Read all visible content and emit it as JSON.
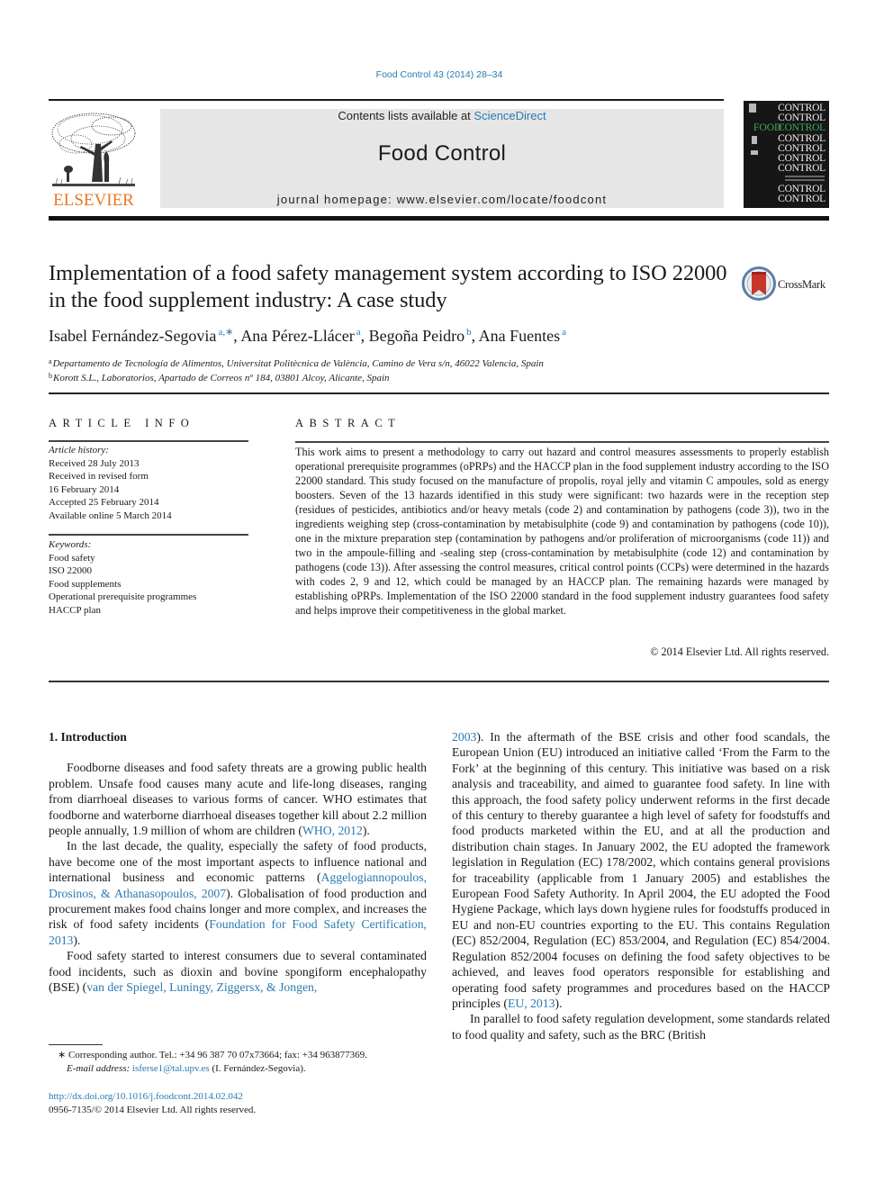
{
  "header": {
    "citation": "Food Control 43 (2014) 28–34",
    "publisher_logo_text": "ELSEVIER",
    "contents_prefix": "Contents lists available at ",
    "contents_link": "ScienceDirect",
    "journal_name": "Food Control",
    "homepage_prefix": "journal homepage: ",
    "homepage_url": "www.elsevier.com/locate/foodcont",
    "cover": {
      "word_control": "CONTROL",
      "word_food": "FOOD"
    },
    "colors": {
      "link": "#2a7ab0",
      "elsevier_orange": "#e87722",
      "masthead_bg": "#e6e6e6",
      "cover_green": "#3fae5a"
    }
  },
  "article": {
    "title": "Implementation of a food safety management system according to ISO 22000 in the food supplement industry: A case study",
    "crossmark_label": "CrossMark",
    "authors": [
      {
        "name": "Isabel Fernández-Segovia",
        "sup": "a,∗"
      },
      {
        "name": "Ana Pérez-Llácer",
        "sup": "a"
      },
      {
        "name": "Begoña Peidro",
        "sup": "b"
      },
      {
        "name": "Ana Fuentes",
        "sup": "a"
      }
    ],
    "affiliations": [
      {
        "mark": "a",
        "text": "Departamento de Tecnología de Alimentos, Universitat Politècnica de València, Camino de Vera s/n, 46022 Valencia, Spain"
      },
      {
        "mark": "b",
        "text": "Korott S.L., Laboratorios, Apartado de Correos nº 184, 03801 Alcoy, Alicante, Spain"
      }
    ]
  },
  "article_info": {
    "heading": "ARTICLE INFO",
    "history_label": "Article history:",
    "history": [
      "Received 28 July 2013",
      "Received in revised form",
      "16 February 2014",
      "Accepted 25 February 2014",
      "Available online 5 March 2014"
    ],
    "keywords_label": "Keywords:",
    "keywords": [
      "Food safety",
      "ISO 22000",
      "Food supplements",
      "Operational prerequisite programmes",
      "HACCP plan"
    ]
  },
  "abstract": {
    "heading": "ABSTRACT",
    "text": "This work aims to present a methodology to carry out hazard and control measures assessments to properly establish operational prerequisite programmes (oPRPs) and the HACCP plan in the food sup­plement industry according to the ISO 22000 standard. This study focused on the manufacture of propolis, royal jelly and vitamin C ampoules, sold as energy boosters. Seven of the 13 hazards identified in this study were significant: two hazards were in the reception step (residues of pesticides, antibiotics and/or heavy metals (code 2) and contamination by pathogens (code 3)), two in the ingredients weighing step (cross-contamination by metabisulphite (code 9) and contamination by pathogens (code 10)), one in the mixture preparation step (contamination by pathogens and/or proliferation of microorganisms (code 11)) and two in the ampoule-filling and -sealing step (cross-contamination by metabisulphite (code 12) and contamination by pathogens (code 13)). After assessing the control measures, critical control points (CCPs) were determined in the hazards with codes 2, 9 and 12, which could be managed by an HACCP plan. The remaining hazards were managed by establishing oPRPs. Implementation of the ISO 22000 standard in the food supplement industry guarantees food safety and helps improve their competi­tiveness in the global market.",
    "copyright": "© 2014 Elsevier Ltd. All rights reserved."
  },
  "body": {
    "section_heading": "1.  Introduction",
    "p1_text": "Foodborne diseases and food safety threats are a growing public health problem. Unsafe food causes many acute and life-long dis­eases, ranging from diarrhoeal diseases to various forms of cancer. WHO estimates that foodborne and waterborne diarrhoeal diseases together kill about 2.2 million people annually, 1.9 million of whom are children (",
    "p1_ref": "WHO, 2012",
    "p1_end": ").",
    "p2_text": "In the last decade, the quality, especially the safety of food products, have become one of the most important aspects to in­fluence national and international business and economic patterns (",
    "p2_ref1": "Aggelogiannopoulos, Drosinos, & Athanasopoulos, 2007",
    "p2_mid": "). Globali­sation of food production and procurement makes food chains longer and more complex, and increases the risk of food safety incidents (",
    "p2_ref2": "Foundation for Food Safety Certification, 2013",
    "p2_end": ").",
    "p3_text": "Food safety started to interest consumers due to several contaminated food incidents, such as dioxin and bovine spongiform encephalopathy (BSE) (",
    "p3_ref_part1": "van der Spiegel, Luningy, Ziggersx, & Jongen,",
    "p3_ref_part2": "2003",
    "p3_cont": "). In the aftermath of the BSE crisis and other food scandals, the European Union (EU) introduced an initiative called ‘From the Farm to the Fork’ at the beginning of this century. This initiative was based on a risk analysis and traceability, and aimed to guarantee food safety. In line with this approach, the food safety policy un­derwent reforms in the first decade of this century to thereby guarantee a high level of safety for foodstuffs and food products marketed within the EU, and at all the production and distribution chain stages. In January 2002, the EU adopted the framework legislation in Regulation (EC) 178/2002, which contains general provisions for traceability (applicable from 1 January 2005) and establishes the European Food Safety Authority. In April 2004, the EU adopted the Food Hygiene Package, which lays down hygiene rules for foodstuffs produced in EU and non-EU countries exporting to the EU. This contains Regulation (EC) 852/2004, Regulation (EC) 853/2004, and Regulation (EC) 854/2004. Regulation 852/2004 focuses on defining the food safety objectives to be achieved, and leaves food operators responsible for establishing and operating food safety programmes and procedures based on the HACCP principles (",
    "p3_ref2": "EU, 2013",
    "p3_end": ").",
    "p4_text": "In parallel to food safety regulation development, some stan­dards related to food quality and safety, such as the BRC (British"
  },
  "footnotes": {
    "corresponding": "∗  Corresponding author. Tel.: +34 96 387 70 07x73664; fax: +34 963877369.",
    "email_label": "E-mail address:",
    "email": "isferse1@tal.upv.es",
    "email_suffix": " (I. Fernández-Segovia).",
    "doi_url": "http://dx.doi.org/10.1016/j.foodcont.2014.02.042",
    "issn_line": "0956-7135/© 2014 Elsevier Ltd. All rights reserved."
  }
}
